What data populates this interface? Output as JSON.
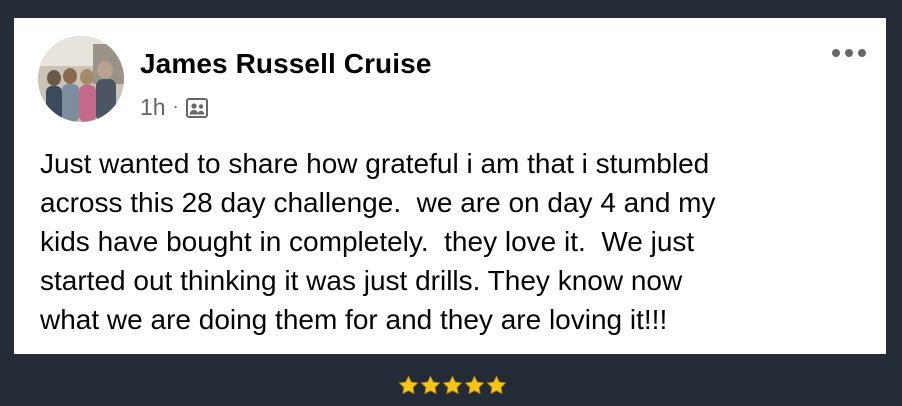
{
  "post": {
    "author": "James Russell Cruise",
    "time": "1h",
    "separator": "·",
    "audience_icon": "friends-icon",
    "body_lines": [
      "Just wanted to share how grateful i am that i stumbled",
      "across this 28 day challenge.  we are on day 4 and my",
      "kids have bought in completely.  they love it.  We just",
      "started out thinking it was just drills. They know now",
      "what we are doing them for and they are loving it!!!"
    ],
    "menu_icon": "more-options-icon"
  },
  "rating": {
    "stars": 5,
    "max": 5,
    "star_color": "#f5c518"
  },
  "colors": {
    "background": "#222b36",
    "card": "#ffffff",
    "text": "#050505",
    "secondary_text": "#65676b"
  }
}
